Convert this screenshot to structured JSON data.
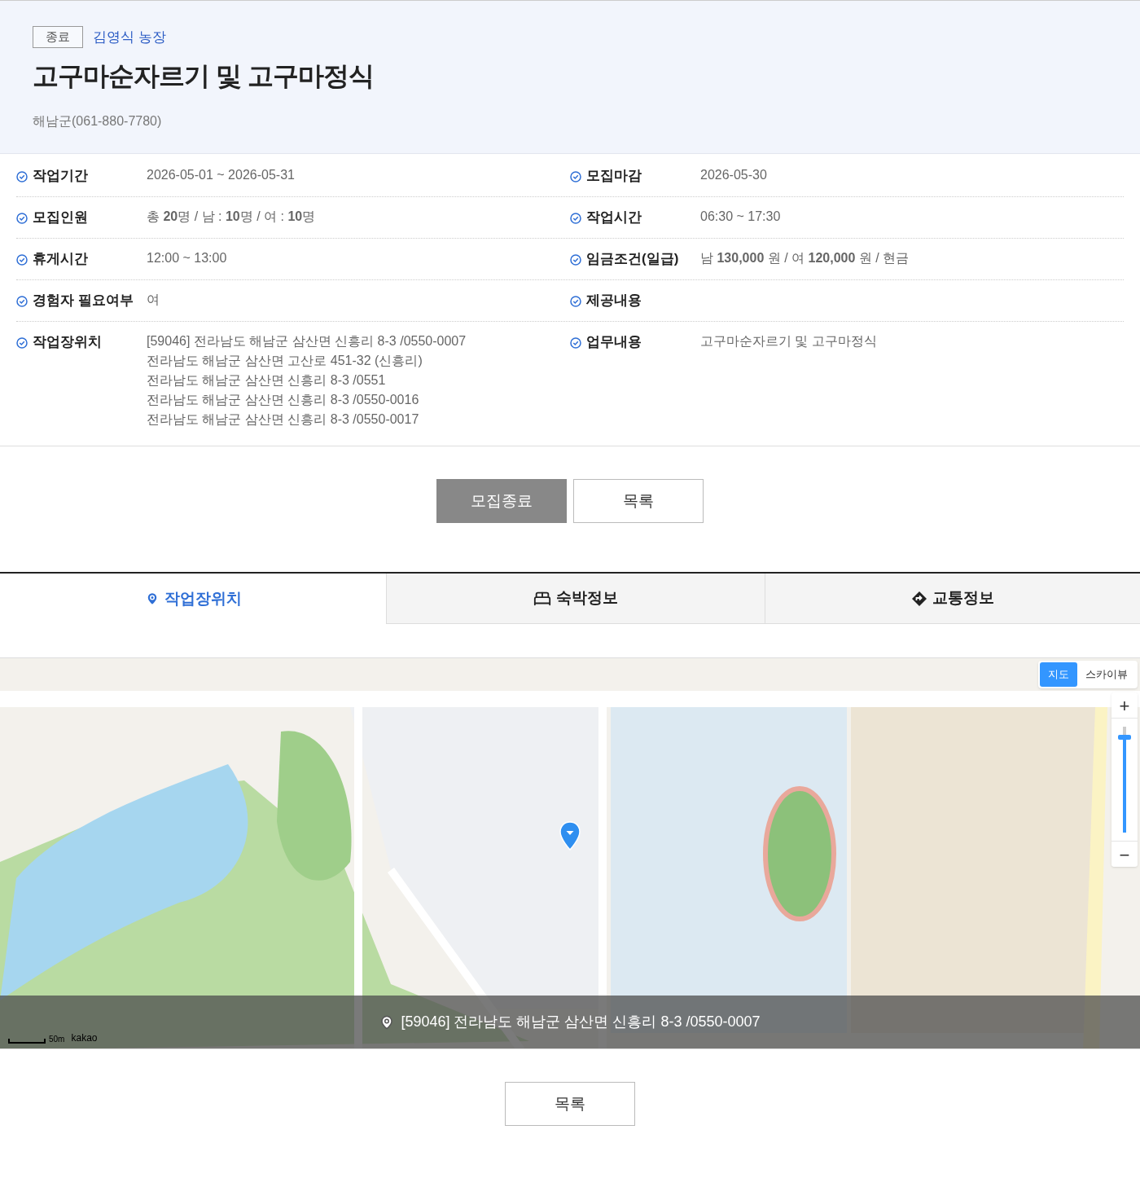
{
  "header": {
    "status_badge": "종료",
    "farm_name": "김영식 농장",
    "title": "고구마순자르기 및 고구마정식",
    "contact": "해남군(061-880-7780)"
  },
  "info_rows": [
    {
      "left": {
        "label": "작업기간",
        "lines": [
          "2026-05-01 ~ 2026-05-31"
        ]
      },
      "right": {
        "label": "모집마감",
        "lines": [
          "2026-05-30"
        ]
      }
    },
    {
      "left": {
        "label": "모집인원",
        "lines": [
          "총 **20**명 / 남 : **10**명 / 여 : **10**명"
        ]
      },
      "right": {
        "label": "작업시간",
        "lines": [
          "06:30 ~ 17:30"
        ]
      }
    },
    {
      "left": {
        "label": "휴게시간",
        "lines": [
          "12:00 ~ 13:00"
        ]
      },
      "right": {
        "label": "임금조건(일급)",
        "lines": [
          "남 **130,000** 원 / 여 **120,000** 원 / 현금"
        ]
      }
    },
    {
      "left": {
        "label": "경험자 필요여부",
        "lines": [
          "여"
        ]
      },
      "right": {
        "label": "제공내용"
      }
    },
    {
      "left": {
        "label": "작업장위치",
        "lines": [
          "[59046] 전라남도 해남군 삼산면 신흥리 8-3 /0550-0007",
          "전라남도 해남군 삼산면 고산로 451-32 (신흥리)",
          "전라남도 해남군 삼산면 신흥리 8-3 /0551",
          "전라남도 해남군 삼산면 신흥리 8-3 /0550-0016",
          "전라남도 해남군 삼산면 신흥리 8-3 /0550-0017"
        ]
      },
      "right": {
        "label": "업무내용",
        "lines": [
          "고구마순자르기 및 고구마정식"
        ]
      }
    }
  ],
  "actions": [
    {
      "label": "모집종료",
      "kind": "closed"
    },
    {
      "label": "목록",
      "kind": "outline"
    }
  ],
  "tabs": [
    {
      "label": "작업장위치",
      "kind": "pin",
      "selected": true
    },
    {
      "label": "숙박정보",
      "kind": "bed",
      "selected": false
    },
    {
      "label": "교통정보",
      "kind": "route",
      "selected": false
    }
  ],
  "map": {
    "view_toggle": [
      {
        "label": "지도",
        "selected": true
      },
      {
        "label": "스카이뷰",
        "selected": false
      }
    ],
    "zoom_in": "+",
    "zoom_out": "−",
    "zoom": {
      "level": 0.9
    },
    "scale": "50m",
    "provider": "kakao",
    "address": "[59046] 전라남도 해남군 삼산면 신흥리 8-3 /0550-0007"
  },
  "bottom_button": "목록"
}
